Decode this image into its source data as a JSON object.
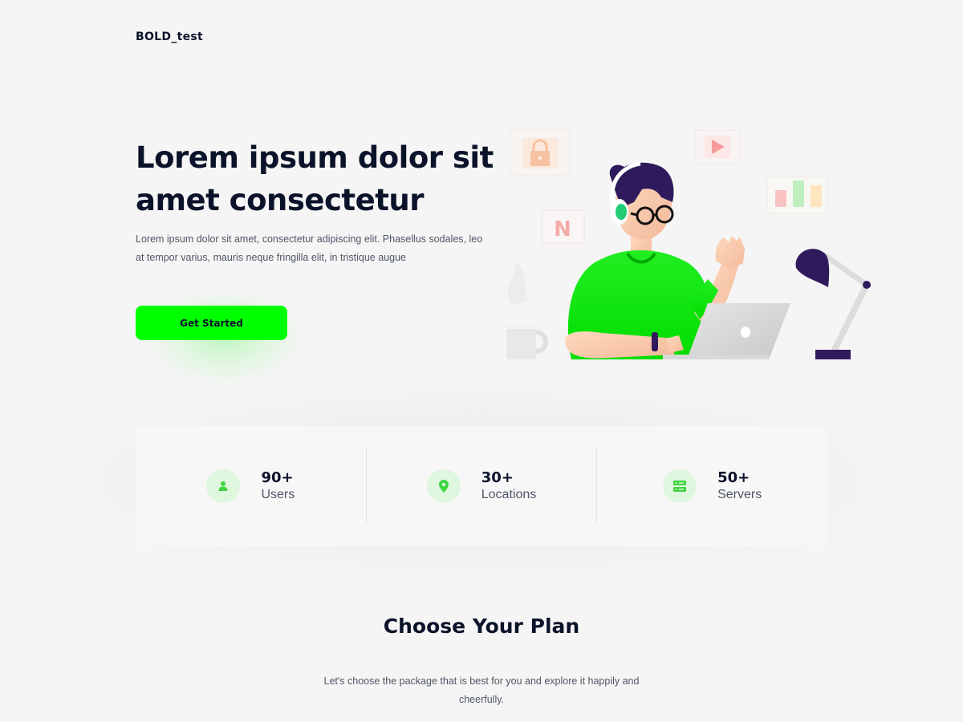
{
  "brand": {
    "logo_text": "BOLD_test"
  },
  "hero": {
    "title": "Lorem ipsum dolor sit amet consectetur",
    "description": "Lorem ipsum dolor sit amet, consectetur adipiscing elit. Phasellus sodales, leo at tempor varius, mauris neque fringilla elit, in tristique augue",
    "cta_label": "Get Started"
  },
  "stats": [
    {
      "icon": "user-icon",
      "value": "90+",
      "label": "Users"
    },
    {
      "icon": "location-pin-icon",
      "value": "30+",
      "label": "Locations"
    },
    {
      "icon": "server-icon",
      "value": "50+",
      "label": "Servers"
    }
  ],
  "plans": {
    "title": "Choose Your Plan",
    "description": "Let's choose the package that is best for you and explore it happily and cheerfully."
  },
  "illustration": {
    "badge_letter": "N",
    "colors": {
      "shirt": "#00ee00",
      "hair": "#2f1b5c",
      "accent": "#00ff00"
    }
  }
}
